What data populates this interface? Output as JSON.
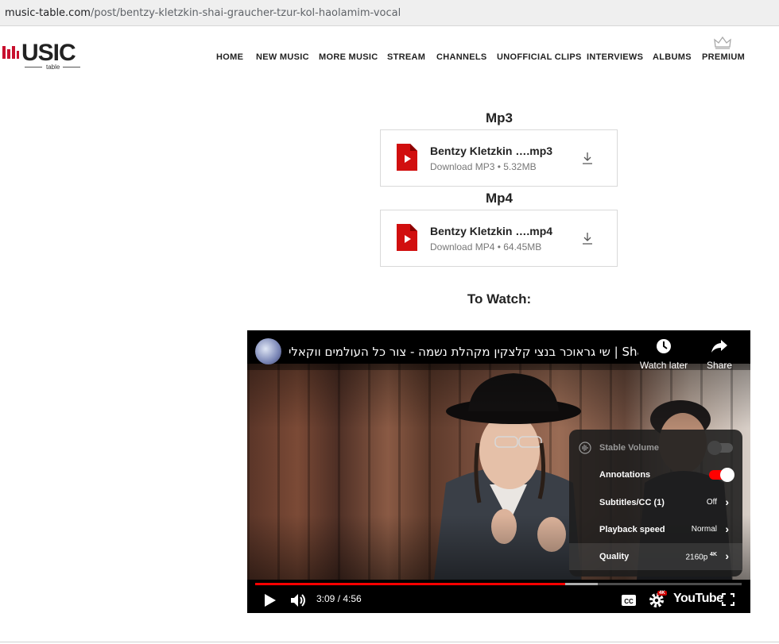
{
  "browser": {
    "url_domain": "music-table.com",
    "url_path": "/post/bentzy-kletzkin-shai-graucher-tzur-kol-haolamim-vocal"
  },
  "logo": {
    "word": "USIC",
    "sub": "table",
    "accent_color": "#c8102e"
  },
  "nav": [
    "HOME",
    "NEW MUSIC",
    "MORE MUSIC",
    "STREAM",
    "CHANNELS",
    "UNOFFICIAL CLIPS",
    "INTERVIEWS",
    "ALBUMS",
    "PREMIUM"
  ],
  "mp3": {
    "heading": "Mp3",
    "name": "Bentzy Kletzkin ….mp3",
    "meta": "Download MP3 • 5.32MB",
    "icon": "pdf-file-icon"
  },
  "mp4": {
    "heading": "Mp4",
    "name": "Bentzy Kletzkin ….mp4",
    "meta": "Download MP4 • 64.45MB",
    "icon": "pdf-file-icon"
  },
  "watch_heading": "To Watch:",
  "video": {
    "title": "שי גראוכר בנצי קלצקין מקהלת נשמה - צור כל העולמים ווקאלי | Shai Gr…",
    "watch_later": "Watch later",
    "share": "Share",
    "time": "3:09 / 4:56",
    "progress_fraction": 0.638,
    "buffered_fraction": 0.705,
    "youtube_label": "YouTube",
    "settings_badge": "4K",
    "settings_menu": {
      "stable_volume": {
        "label": "Stable Volume",
        "enabled": false
      },
      "annotations": {
        "label": "Annotations",
        "enabled": true
      },
      "subtitles": {
        "label": "Subtitles/CC (1)",
        "value": "Off"
      },
      "playback_speed": {
        "label": "Playback speed",
        "value": "Normal"
      },
      "quality": {
        "label": "Quality",
        "value": "2160p",
        "badge": "4K"
      }
    }
  }
}
